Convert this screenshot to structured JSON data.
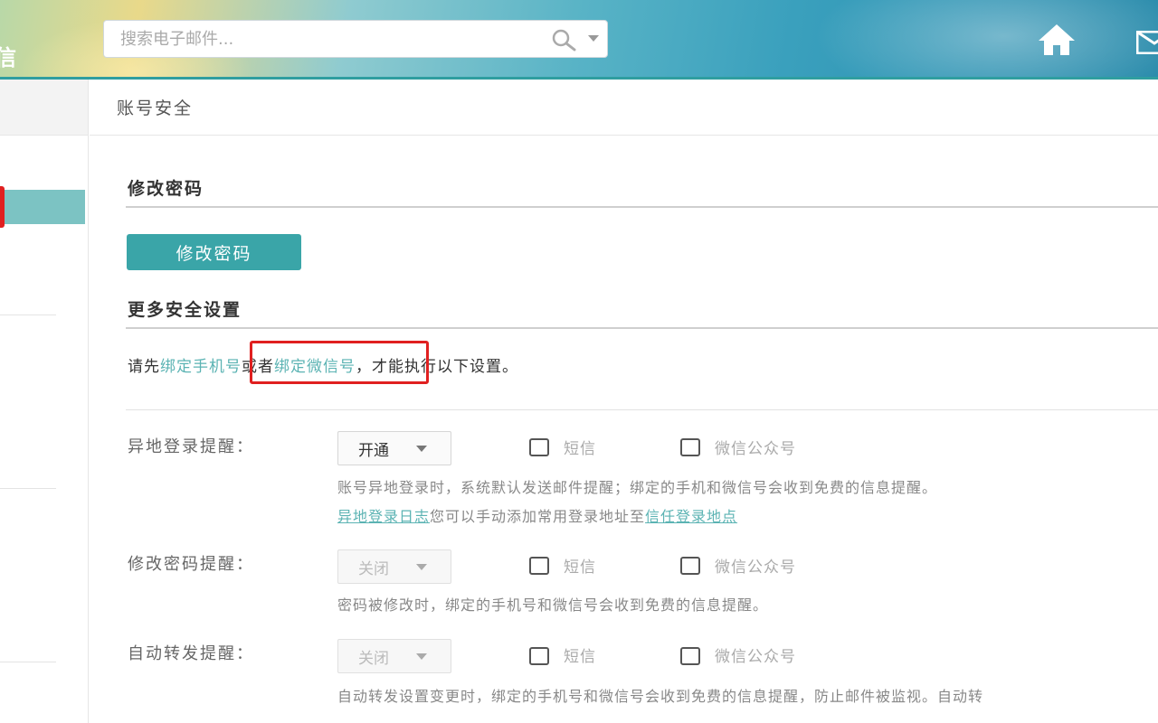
{
  "header": {
    "logo_fragment": "信",
    "search": {
      "placeholder": "搜索电子邮件..."
    }
  },
  "breadcrumb": "账号安全",
  "password_section": {
    "title": "修改密码",
    "button_label": "修改密码"
  },
  "more_section": {
    "title": "更多安全设置",
    "notice": {
      "prefix": "请先",
      "bind_phone": "绑定手机号",
      "or": "或者",
      "bind_wechat": "绑定微信号",
      "suffix": "，才能执行以下设置。"
    }
  },
  "settings": [
    {
      "label": "异地登录提醒：",
      "select_value": "开通",
      "option_sms": "短信",
      "option_wechat": "微信公众号",
      "desc": "账号异地登录时，系统默认发送邮件提醒；绑定的手机和微信号会收到免费的信息提醒。",
      "link_login_log": "异地登录日志",
      "link_mid_text": "您可以手动添加常用登录地址至",
      "link_trusted": "信任登录地点"
    },
    {
      "label": "修改密码提醒：",
      "select_value": "关闭",
      "option_sms": "短信",
      "option_wechat": "微信公众号",
      "desc": "密码被修改时，绑定的手机号和微信号会收到免费的信息提醒。"
    },
    {
      "label": "自动转发提醒：",
      "select_value": "关闭",
      "option_sms": "短信",
      "option_wechat": "微信公众号",
      "desc": "自动转发设置变更时，绑定的手机号和微信号会收到免费的信息提醒，防止邮件被监视。自动转"
    }
  ],
  "colors": {
    "accent": "#3aa5a8",
    "link": "#5bb3b3",
    "highlight": "#e02020"
  }
}
